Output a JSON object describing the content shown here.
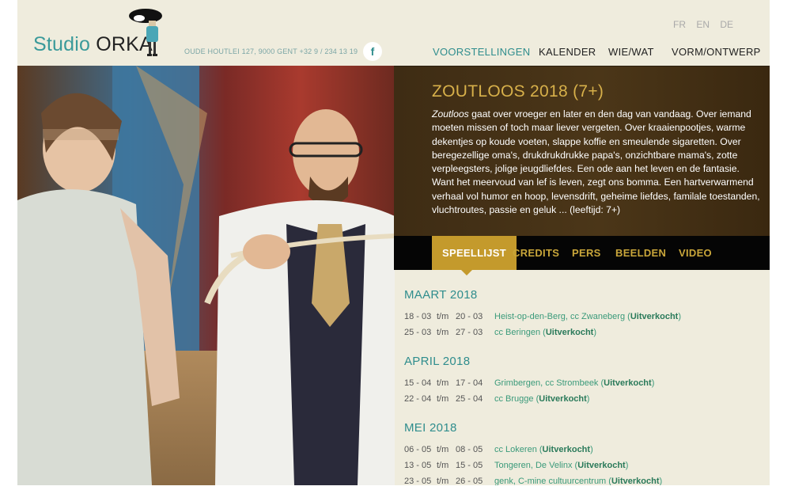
{
  "header": {
    "logo_word1": "Studio",
    "logo_word2": "ORKA",
    "address": "OUDE HOUTLEI 127, 9000 GENT +32 9 / 234 13 19",
    "facebook": "f",
    "langs": [
      "FR",
      "EN",
      "DE"
    ],
    "nav": [
      "VOORSTELLINGEN",
      "KALENDER",
      "WIE/WAT",
      "VORM/ONTWERP"
    ]
  },
  "show": {
    "title": "ZOUTLOOS 2018 (7+)",
    "desc_lead": "Zoutloos",
    "desc_body": " gaat over vroeger en later en den dag van vandaag. Over iemand moeten missen of toch maar liever vergeten. Over kraaienpootjes, warme dekentjes op koude voeten, slappe koffie en smeulende sigaretten. Over beregezellige oma's, drukdrukdrukke papa's, onzichtbare mama's, zotte verpleegsters, jolige jeugdliefdes. Een ode aan het leven en de fantasie. Want het meervoud van lef is leven, zegt ons bomma. Een hartverwarmend verhaal vol humor en hoop, levensdrift, geheime liefdes, familale toestanden, vluchtroutes, passie en geluk ... (leeftijd: 7+)"
  },
  "tabs": [
    "SPEELLIJST",
    "CREDITS",
    "PERS",
    "BEELDEN",
    "VIDEO"
  ],
  "playlist": {
    "tm": "t/m",
    "sold": "Uitverkocht",
    "months": [
      {
        "name": "MAART 2018",
        "rows": [
          {
            "from": "18 - 03",
            "to": "20 - 03",
            "loc": "Heist-op-den-Berg, cc Zwaneberg"
          },
          {
            "from": "25 - 03",
            "to": "27 - 03",
            "loc": "cc Beringen"
          }
        ]
      },
      {
        "name": "APRIL 2018",
        "rows": [
          {
            "from": "15 - 04",
            "to": "17 - 04",
            "loc": "Grimbergen, cc Strombeek"
          },
          {
            "from": "22 - 04",
            "to": "25 - 04",
            "loc": "cc Brugge"
          }
        ]
      },
      {
        "name": "MEI 2018",
        "rows": [
          {
            "from": "06 - 05",
            "to": "08 - 05",
            "loc": "cc Lokeren"
          },
          {
            "from": "13 - 05",
            "to": "15 - 05",
            "loc": "Tongeren, De Velinx"
          },
          {
            "from": "23 - 05",
            "to": "26 - 05",
            "loc": "genk, C-mine cultuurcentrum"
          }
        ]
      }
    ]
  }
}
